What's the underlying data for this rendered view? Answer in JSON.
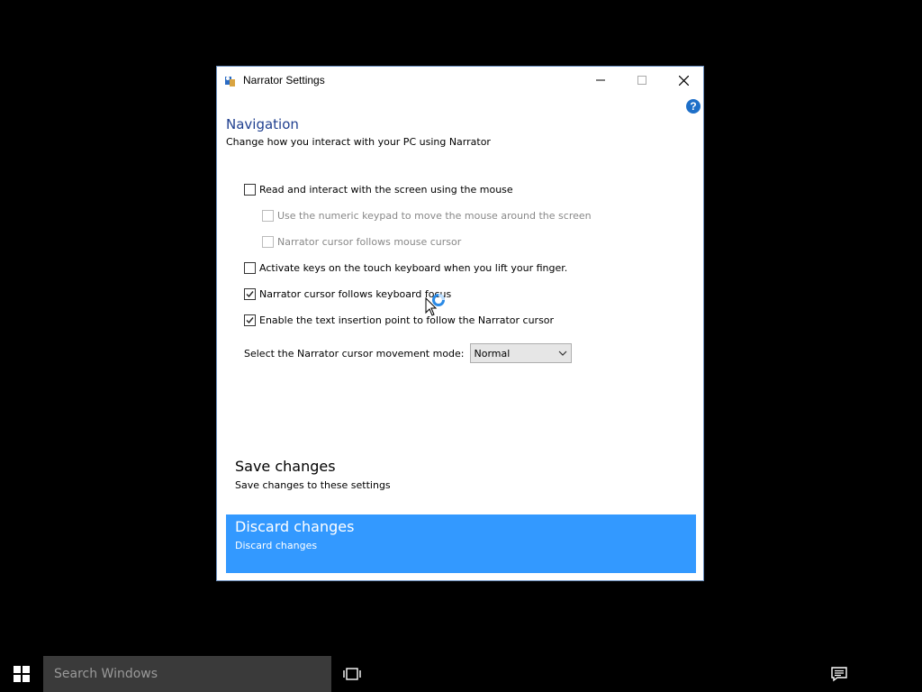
{
  "window": {
    "title": "Narrator Settings",
    "help_label": "?",
    "heading": "Navigation",
    "subheading": "Change how you interact with your PC using Narrator",
    "options": [
      {
        "label": "Read and interact with the screen using the mouse",
        "checked": false,
        "enabled": true
      },
      {
        "label": "Use the numeric keypad to move the mouse around the screen",
        "checked": false,
        "enabled": false
      },
      {
        "label": "Narrator cursor follows mouse cursor",
        "checked": false,
        "enabled": false
      },
      {
        "label": "Activate keys on the touch keyboard when you lift your finger.",
        "checked": false,
        "enabled": true
      },
      {
        "label": "Narrator cursor follows keyboard focus",
        "checked": true,
        "enabled": true
      },
      {
        "label": "Enable the text insertion point to follow the Narrator cursor",
        "checked": true,
        "enabled": true
      }
    ],
    "movement_mode": {
      "label": "Select the Narrator cursor movement mode:",
      "value": "Normal"
    },
    "save": {
      "title": "Save changes",
      "description": "Save changes to these settings"
    },
    "discard": {
      "title": "Discard changes",
      "description": "Discard changes"
    }
  },
  "taskbar": {
    "search_placeholder": "Search Windows"
  },
  "colors": {
    "highlight": "#3399ff",
    "heading": "#1f3f8f",
    "desktop": "#000000"
  }
}
